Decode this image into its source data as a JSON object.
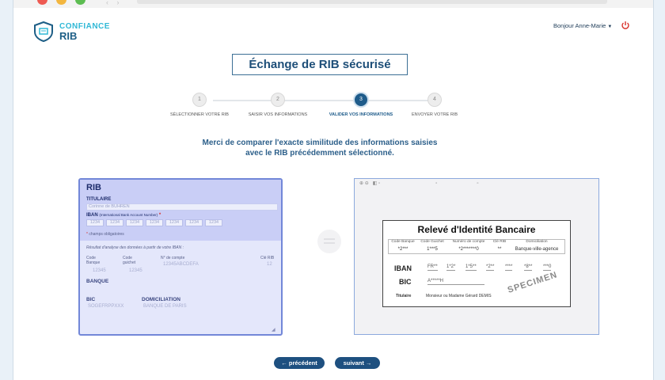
{
  "app": {
    "logo_line1": "CONFIANCE",
    "logo_line2": "RIB",
    "greeting": "Bonjour Anne-Marie",
    "brand_colors": {
      "primary": "#1e5080",
      "accent": "#2fb8d6",
      "form_border": "#7287d8",
      "power": "#d9312a"
    }
  },
  "page": {
    "title": "Échange de RIB sécurisé",
    "instruction_line1": "Merci de comparer l'exacte similitude des informations saisies",
    "instruction_line2": "avec le RIB précédemment sélectionné."
  },
  "steps": [
    {
      "number": "1",
      "label": "SÉLECTIONNER VOTRE RIB",
      "active": false
    },
    {
      "number": "2",
      "label": "SAISIR VOS INFORMATIONS",
      "active": false
    },
    {
      "number": "3",
      "label": "VALIDER VOS INFORMATIONS",
      "active": true
    },
    {
      "number": "4",
      "label": "ENVOYER VOTRE RIB",
      "active": false
    }
  ],
  "form": {
    "title": "RIB",
    "titulaire_label": "TITULAIRE",
    "titulaire_value": "Corinne de BUHREN",
    "iban_label": "IBAN",
    "iban_sublabel": "(International Bank Account Number)",
    "iban_required": "*",
    "iban_blocks": [
      "1234",
      "1234",
      "1234",
      "1234",
      "1234",
      "1234",
      "1234"
    ],
    "required_note": "champs obligatoires",
    "analysis_note": "Résultat d'analyse des données à partir de votre IBAN :",
    "code_banque_label": "Code Banque",
    "code_banque_value": "12345",
    "code_guichet_label": "Code guichet",
    "code_guichet_value": "12345",
    "num_compte_label": "N° de compte",
    "num_compte_value": "12345ABCDEFA",
    "cle_rib_label": "Clé RIB",
    "cle_rib_value": "12",
    "banque_label": "BANQUE",
    "bic_label": "BIC",
    "bic_value": "SOGEFRPPXXX",
    "domiciliation_label": "DOMICILIATION",
    "domiciliation_value": "BANQUE DE PARIS"
  },
  "document": {
    "title": "Relevé d'Identité Bancaire",
    "headers": [
      "Code Banque",
      "Code Guichet",
      "Numéro de compte",
      "Clé RIB",
      "Domiciliation"
    ],
    "values": [
      "*2***",
      "1***5",
      "*2*******0",
      "**",
      "Banque-ville-agence"
    ],
    "iban_label": "IBAN",
    "iban_blocks": [
      "FR**",
      "1*2*",
      "1*5**",
      "*2**",
      "****",
      "*8**",
      "***0"
    ],
    "bic_label": "BIC",
    "bic_value": "A*****H",
    "titulaire_label": "Titulaire",
    "titulaire_value": "Monsieur ou Madame Gérard DEMIS",
    "watermark": "SPECIMEN"
  },
  "nav": {
    "prev_label": "précédent",
    "next_label": "suivant"
  }
}
